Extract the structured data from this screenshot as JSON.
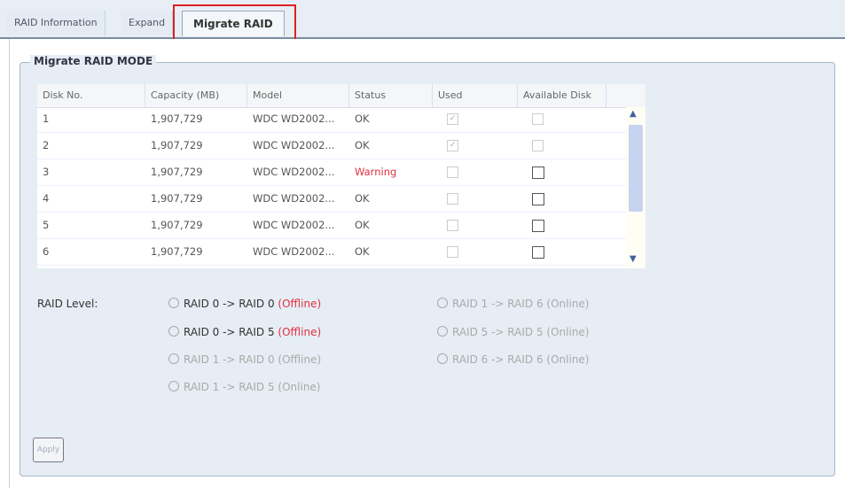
{
  "tabs": [
    {
      "label": "RAID Information"
    },
    {
      "label": "Expand"
    },
    {
      "label": "Migrate RAID"
    }
  ],
  "section_title": "Migrate RAID MODE",
  "table": {
    "headers": [
      "Disk No.",
      "Capacity (MB)",
      "Model",
      "Status",
      "Used",
      "Available Disk"
    ],
    "rows": [
      {
        "disk": "1",
        "capacity": "1,907,729",
        "model": "WDC WD2002...",
        "status": "OK",
        "used": true,
        "available_enabled": false
      },
      {
        "disk": "2",
        "capacity": "1,907,729",
        "model": "WDC WD2002...",
        "status": "OK",
        "used": true,
        "available_enabled": false
      },
      {
        "disk": "3",
        "capacity": "1,907,729",
        "model": "WDC WD2002...",
        "status": "Warning",
        "used": false,
        "available_enabled": true
      },
      {
        "disk": "4",
        "capacity": "1,907,729",
        "model": "WDC WD2002...",
        "status": "OK",
        "used": false,
        "available_enabled": true
      },
      {
        "disk": "5",
        "capacity": "1,907,729",
        "model": "WDC WD2002...",
        "status": "OK",
        "used": false,
        "available_enabled": true
      },
      {
        "disk": "6",
        "capacity": "1,907,729",
        "model": "WDC WD2002...",
        "status": "OK",
        "used": false,
        "available_enabled": true
      }
    ]
  },
  "raid_level": {
    "label": "RAID Level:",
    "options": [
      {
        "text": "RAID 0 -> RAID 0",
        "mode": "(Offline)",
        "enabled": true
      },
      {
        "text": "RAID 0 -> RAID 5",
        "mode": "(Offline)",
        "enabled": true
      },
      {
        "text": "RAID 1 -> RAID 0",
        "mode": "(Offline)",
        "enabled": false
      },
      {
        "text": "RAID 1 -> RAID 5",
        "mode": "(Online)",
        "enabled": false
      },
      {
        "text": "RAID 1 -> RAID 6",
        "mode": "(Online)",
        "enabled": false
      },
      {
        "text": "RAID 5 -> RAID 5",
        "mode": "(Online)",
        "enabled": false
      },
      {
        "text": "RAID 6 -> RAID 6",
        "mode": "(Online)",
        "enabled": false
      }
    ]
  },
  "apply_label": "Apply",
  "colors": {
    "highlight": "#dd2222",
    "warning": "#e03040"
  }
}
